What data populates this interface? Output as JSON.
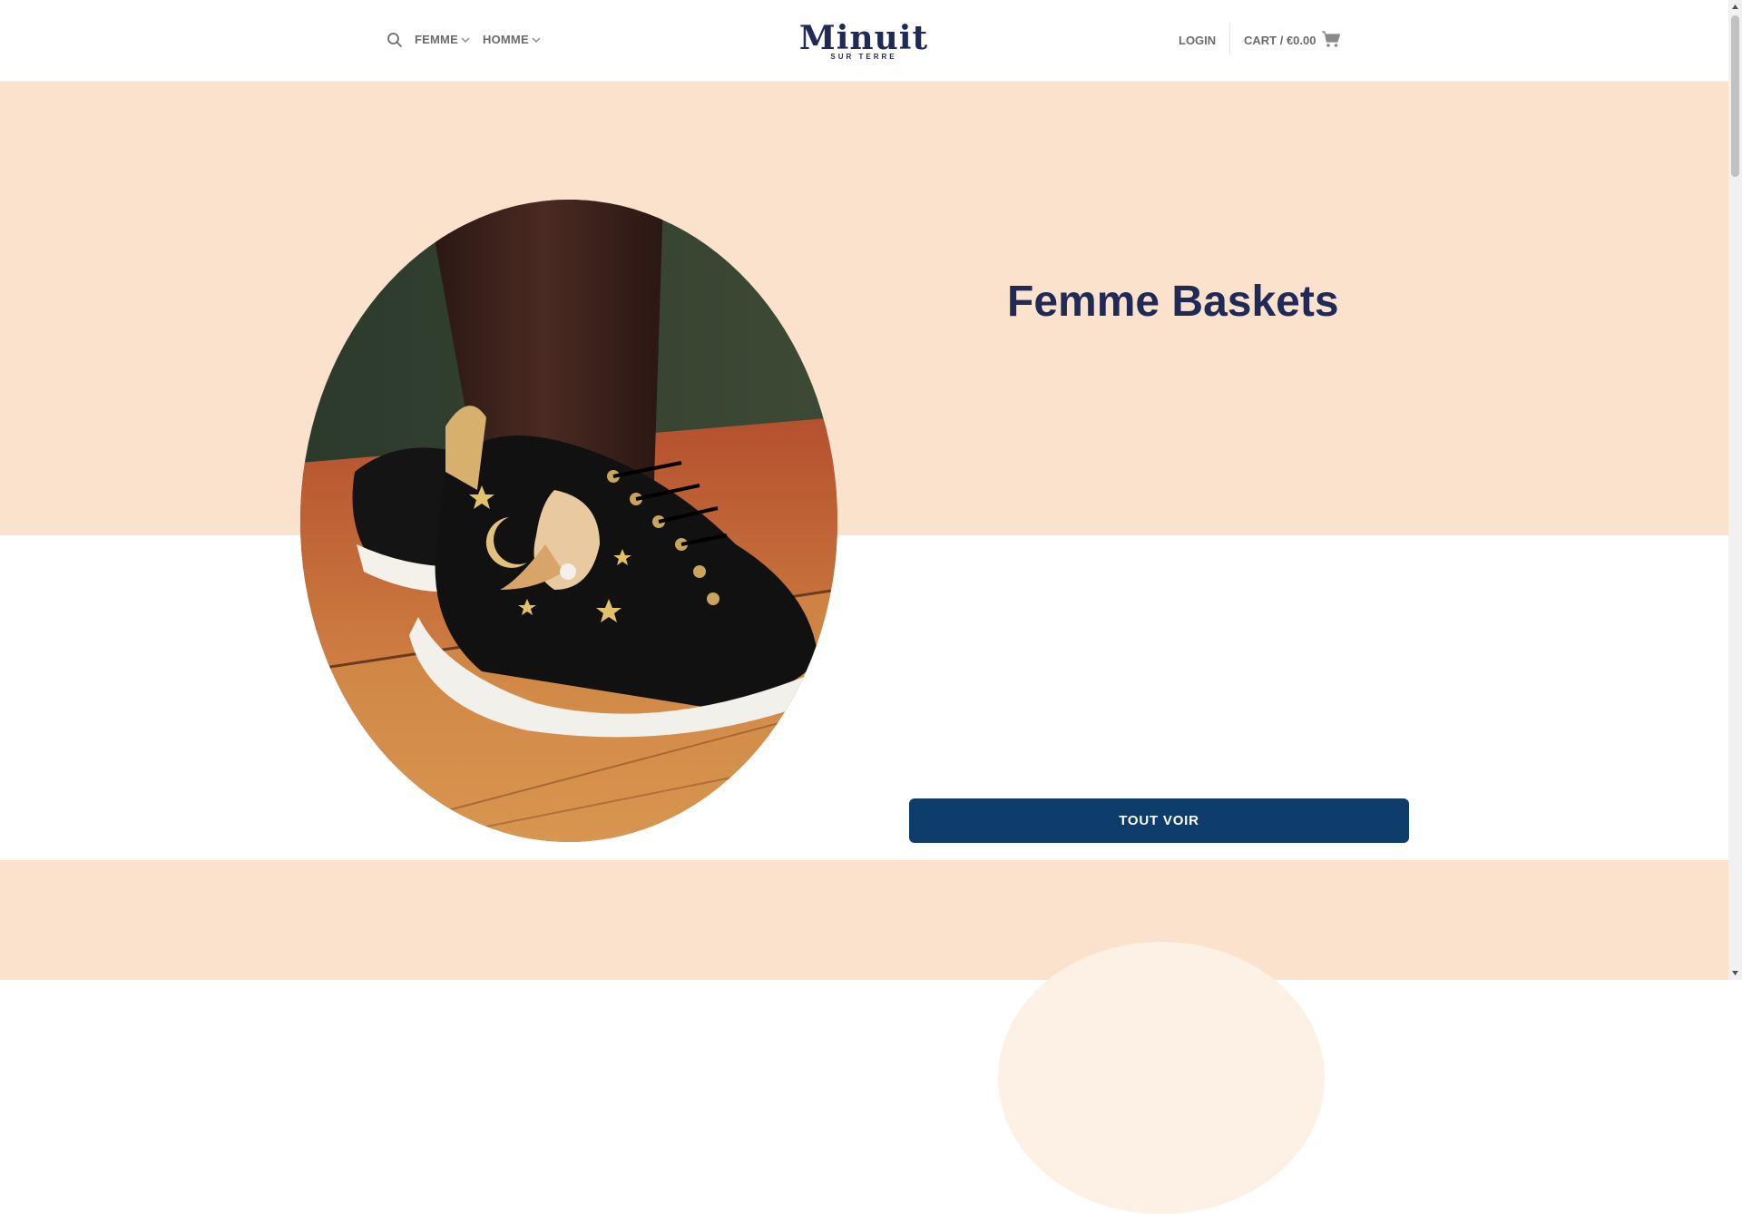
{
  "header": {
    "nav": {
      "femme": "FEMME",
      "homme": "HOMME"
    },
    "logo": {
      "word": "Minuit",
      "subtitle": "SUR TERRE"
    },
    "login": "LOGIN",
    "cart": "CART / €0.00",
    "icons": {
      "search": "search-icon",
      "chevron": "chevron-down-icon",
      "cart": "cart-icon"
    }
  },
  "hero": {
    "title": "Femme Baskets",
    "cta": "TOUT VOIR",
    "image": "black sneaker with embroidered owl, moon and stars on wooden floor"
  },
  "colors": {
    "brand_navy": "#1f2a56",
    "button_blue": "#0e3c6b",
    "peach": "#fbe2cc",
    "nav_gray": "#6b6b6b"
  }
}
